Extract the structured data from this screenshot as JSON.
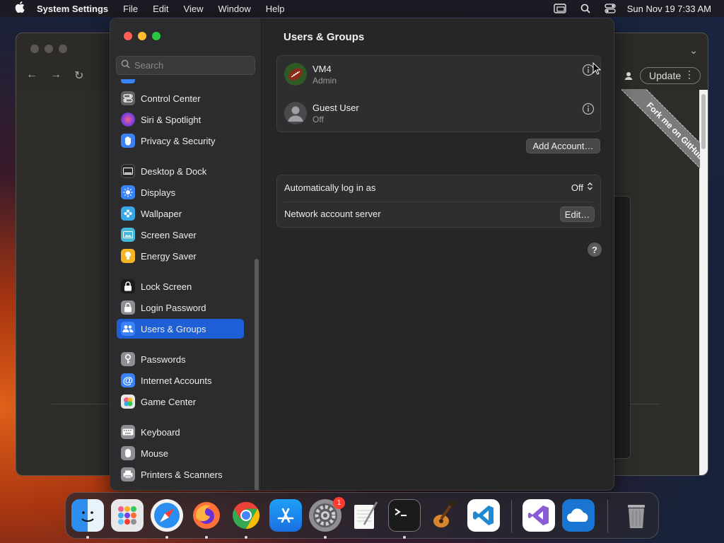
{
  "menubar": {
    "app_name": "System Settings",
    "menus": [
      "File",
      "Edit",
      "View",
      "Window",
      "Help"
    ],
    "clock": "Sun Nov 19  7:33 AM"
  },
  "browser": {
    "update_label": "Update",
    "ribbon_text": "Fork me on GitHub"
  },
  "settings": {
    "search_placeholder": "Search",
    "sidebar": {
      "items": [
        {
          "label": "Control Center",
          "icon": "control-center-icon",
          "color": "#636366"
        },
        {
          "label": "Siri & Spotlight",
          "icon": "siri-icon",
          "color": "#b04ad8"
        },
        {
          "label": "Privacy & Security",
          "icon": "hand-icon",
          "color": "#3a82f7"
        },
        {
          "label": "Desktop & Dock",
          "icon": "dock-icon",
          "color": "#2a2a2c"
        },
        {
          "label": "Displays",
          "icon": "sun-icon",
          "color": "#3a82f7"
        },
        {
          "label": "Wallpaper",
          "icon": "wallpaper-icon",
          "color": "#38a8e8"
        },
        {
          "label": "Screen Saver",
          "icon": "screen-saver-icon",
          "color": "#48b8d8"
        },
        {
          "label": "Energy Saver",
          "icon": "bulb-icon",
          "color": "#f5b423"
        },
        {
          "label": "Lock Screen",
          "icon": "lock-icon",
          "color": "#1c1c1e"
        },
        {
          "label": "Login Password",
          "icon": "login-lock-icon",
          "color": "#8e8e93"
        },
        {
          "label": "Users & Groups",
          "icon": "users-icon",
          "color": "#3a82f7"
        },
        {
          "label": "Passwords",
          "icon": "key-icon",
          "color": "#8e8e93"
        },
        {
          "label": "Internet Accounts",
          "icon": "at-icon",
          "color": "#3a82f7"
        },
        {
          "label": "Game Center",
          "icon": "game-center-icon",
          "color": "#e8e8e8"
        },
        {
          "label": "Keyboard",
          "icon": "keyboard-icon",
          "color": "#8e8e93"
        },
        {
          "label": "Mouse",
          "icon": "mouse-icon",
          "color": "#8e8e93"
        },
        {
          "label": "Printers & Scanners",
          "icon": "printer-icon",
          "color": "#8e8e93"
        }
      ],
      "selected": "Users & Groups"
    },
    "main": {
      "title": "Users & Groups",
      "users": [
        {
          "name": "VM4",
          "role": "Admin"
        },
        {
          "name": "Guest User",
          "role": "Off"
        }
      ],
      "add_account_label": "Add Account…",
      "auto_login_label": "Automatically log in as",
      "auto_login_value": "Off",
      "network_server_label": "Network account server",
      "edit_label": "Edit…",
      "help_label": "?"
    }
  },
  "dock": {
    "apps": [
      "Finder",
      "Launchpad",
      "Safari",
      "Firefox",
      "Chrome",
      "App Store",
      "System Settings",
      "TextEdit",
      "Terminal",
      "GarageBand",
      "VS Code",
      "Visual Studio",
      "OneDrive",
      "Trash"
    ],
    "settings_badge": "1"
  }
}
